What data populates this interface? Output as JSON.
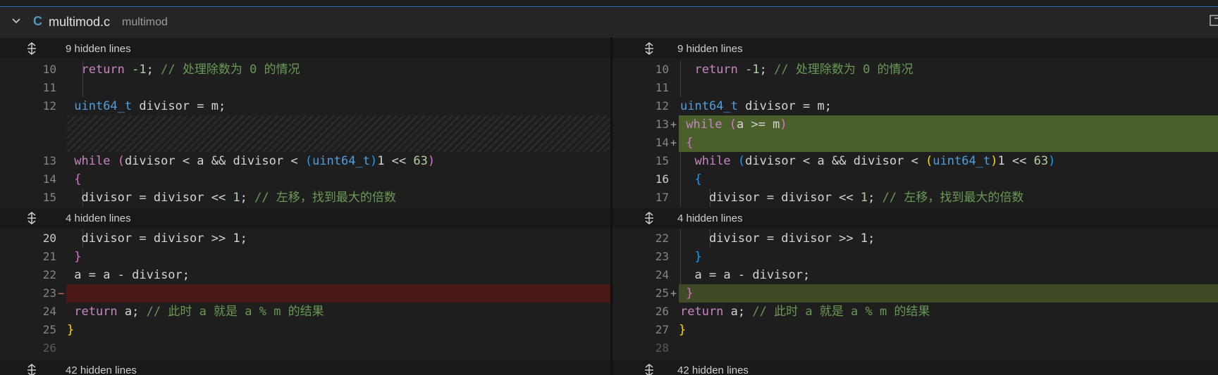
{
  "header": {
    "language_icon": "C",
    "file_name": "multimod.c",
    "folder": "multimod",
    "right_icon": "open-file-icon"
  },
  "hidden": {
    "top": "9 hidden lines",
    "middle": "4 hidden lines",
    "bottom": "42 hidden lines"
  },
  "left": {
    "lines": {
      "l10": "10",
      "l11": "11",
      "l12": "12",
      "l13": "13",
      "l14": "14",
      "l15": "15",
      "l20": "20",
      "l21": "21",
      "l22": "22",
      "l23": "23",
      "l24": "24",
      "l25": "25",
      "l26": "26"
    },
    "deleted_marker": "−"
  },
  "right": {
    "lines": {
      "l10": "10",
      "l11": "11",
      "l12": "12",
      "l13": "13",
      "l14": "14",
      "l15": "15",
      "l16": "16",
      "l17": "17",
      "l22": "22",
      "l23": "23",
      "l24": "24",
      "l25": "25",
      "l26": "26",
      "l27": "27",
      "l28": "28"
    },
    "added_marker": "+"
  },
  "code": {
    "return_neg": "return",
    "neg_one": "-1",
    "semicolon": ";",
    "comment_zero": "// 处理除数为 0 的情况",
    "uint64": "uint64_t",
    "divisor_decl": " divisor = m;",
    "while_kw": "while",
    "while_cond_a": "a >= m",
    "while_inner_1": "divisor < a && divisor < ",
    "cast_type": "uint64_t",
    "one_shift": "1 << ",
    "sixty_three": "63",
    "open_brace": "{",
    "close_brace": "}",
    "shift_left": "divisor = divisor << ",
    "one": "1",
    "comment_shift": "// 左移，找到最大的倍数",
    "shift_right": "divisor = divisor >> 1;",
    "subtract": "a = a - divisor;",
    "return_kw": "return",
    "return_a": " a; ",
    "comment_result": "// 此时 a 就是 a % m 的结果",
    "open_paren": "(",
    "close_paren": ")"
  }
}
